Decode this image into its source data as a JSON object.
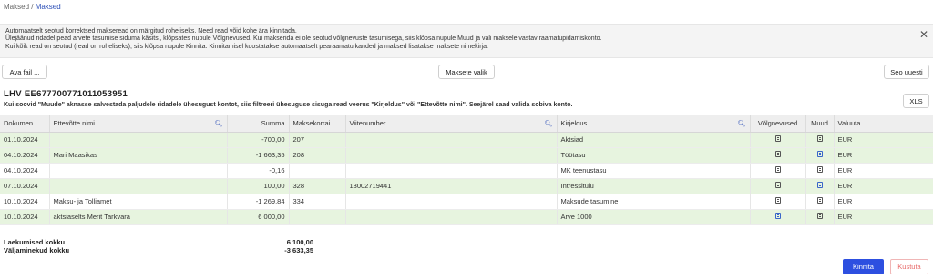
{
  "breadcrumb": {
    "parent": "Maksed",
    "sep": " / ",
    "current": "Maksed"
  },
  "info": {
    "lines": [
      "Automaatselt seotud korrektsed makseread on märgitud roheliseks. Need read võid kohe ära kinnitada.",
      "Ülejäänud ridadel pead arvete tasumise siduma käsitsi, klõpsates nupule Võlgnevused. Kui makserida ei ole seotud võlgnevuste tasumisega, siis klõpsa nupule Muud ja vali maksele vastav raamatupidamiskonto.",
      "Kui kõik read on seotud (read on roheliseks), siis klõpsa nupule Kinnita. Kinnitamisel koostatakse automaatselt pearaamatu kanded ja maksed lisatakse maksete nimekirja."
    ]
  },
  "toolbar": {
    "open_file": "Ava fail ...",
    "select_payments": "Maksete valik",
    "link_again": "Seo uuesti"
  },
  "account": {
    "title": "LHV  EE677700771011053951"
  },
  "hint": "Kui soovid \"Muude\" aknasse salvestada paljudele ridadele ühesugust kontot, siis filtreeri ühesuguse sisuga read veerus \"Kirjeldus\" või \"Ettevõtte nimi\". Seejärel saad valida sobiva konto.",
  "xls_label": "XLS",
  "table": {
    "headers": [
      "Dokumen...",
      "Ettevõtte nimi",
      "Summa",
      "Maksekorrai...",
      "Viitenumber",
      "Kirjeldus",
      "Võlgnevused",
      "Muud",
      "Valuuta"
    ],
    "rows": [
      {
        "status": "green",
        "date": "01.10.2024",
        "company": "",
        "amount": "-700,00",
        "order": "207",
        "ref": "",
        "desc": "Aktsiad",
        "muud_active": false,
        "currency": "EUR"
      },
      {
        "status": "green",
        "date": "04.10.2024",
        "company": "Mari Maasikas",
        "amount": "-1 663,35",
        "order": "208",
        "ref": "",
        "desc": "Töötasu",
        "muud_active": true,
        "currency": "EUR"
      },
      {
        "status": "white",
        "date": "04.10.2024",
        "company": "",
        "amount": "-0,16",
        "order": "",
        "ref": "",
        "desc": "MK teenustasu",
        "muud_active": false,
        "currency": "EUR"
      },
      {
        "status": "green",
        "date": "07.10.2024",
        "company": "",
        "amount": "100,00",
        "order": "328",
        "ref": "13002719441",
        "desc": "Intressitulu",
        "muud_active": true,
        "currency": "EUR"
      },
      {
        "status": "white",
        "date": "10.10.2024",
        "company": "Maksu- ja Tolliamet",
        "amount": "-1 269,84",
        "order": "334",
        "ref": "",
        "desc": "Maksude tasumine",
        "muud_active": false,
        "currency": "EUR"
      },
      {
        "status": "green",
        "date": "10.10.2024",
        "company": "aktsiaselts Merit Tarkvara",
        "amount": "6 000,00",
        "order": "",
        "ref": "",
        "desc": "Arve 1000",
        "volg_active": true,
        "muud_active": false,
        "currency": "EUR"
      }
    ]
  },
  "totals": {
    "incoming_label": "Laekumised kokku",
    "incoming_value": "6 100,00",
    "outgoing_label": "Väljaminekud kokku",
    "outgoing_value": "-3 633,35"
  },
  "actions": {
    "confirm": "Kinnita",
    "delete": "Kustuta"
  },
  "colors": {
    "accent": "#2d4fe0",
    "linked_row": "#e7f4df",
    "danger": "#e86a6a"
  }
}
